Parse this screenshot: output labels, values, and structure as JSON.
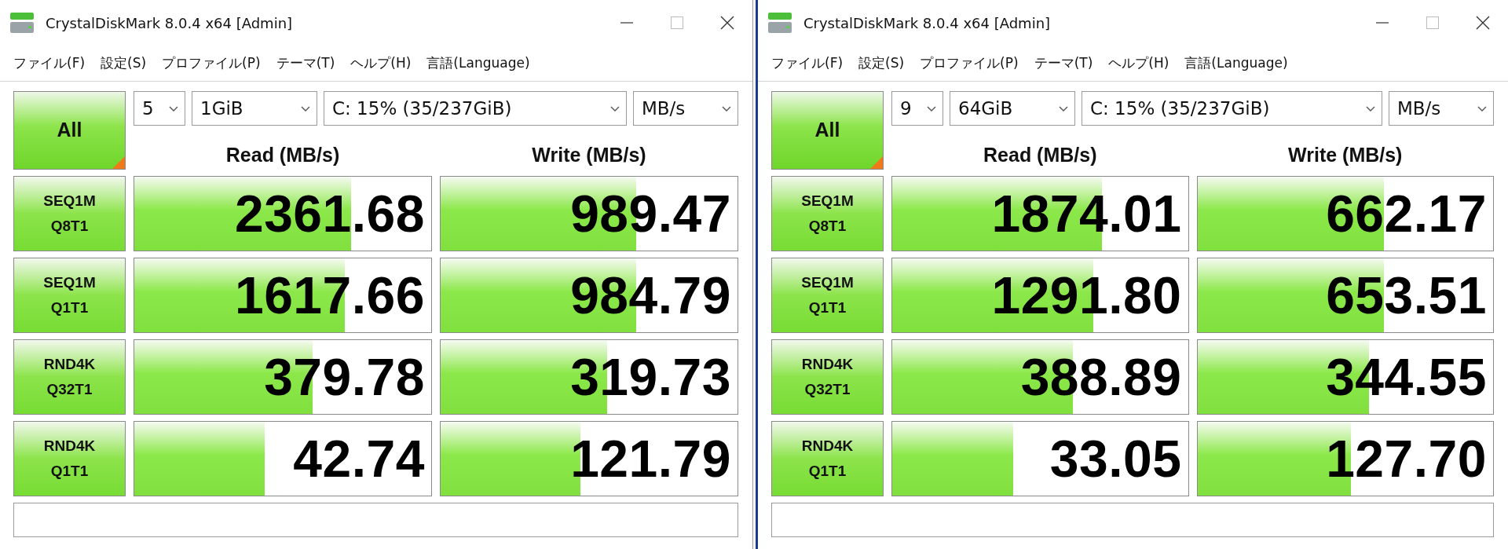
{
  "windows": [
    {
      "title": "CrystalDiskMark 8.0.4 x64 [Admin]",
      "menu": [
        "ファイル(F)",
        "設定(S)",
        "プロファイル(P)",
        "テーマ(T)",
        "ヘルプ(H)",
        "言語(Language)"
      ],
      "all_button": "All",
      "count": "5",
      "size": "1GiB",
      "drive": "C: 15% (35/237GiB)",
      "unit": "MB/s",
      "read_header": "Read (MB/s)",
      "write_header": "Write (MB/s)",
      "tests": [
        {
          "name": "SEQ1M",
          "params": "Q8T1",
          "read": {
            "value": "2361.68",
            "level": 0.73
          },
          "write": {
            "value": "989.47",
            "level": 0.66
          }
        },
        {
          "name": "SEQ1M",
          "params": "Q1T1",
          "read": {
            "value": "1617.66",
            "level": 0.71
          },
          "write": {
            "value": "984.79",
            "level": 0.66
          }
        },
        {
          "name": "RND4K",
          "params": "Q32T1",
          "read": {
            "value": "379.78",
            "level": 0.6
          },
          "write": {
            "value": "319.73",
            "level": 0.56
          }
        },
        {
          "name": "RND4K",
          "params": "Q1T1",
          "read": {
            "value": "42.74",
            "level": 0.44
          },
          "write": {
            "value": "121.79",
            "level": 0.47
          }
        }
      ]
    },
    {
      "title": "CrystalDiskMark 8.0.4 x64 [Admin]",
      "menu": [
        "ファイル(F)",
        "設定(S)",
        "プロファイル(P)",
        "テーマ(T)",
        "ヘルプ(H)",
        "言語(Language)"
      ],
      "all_button": "All",
      "count": "9",
      "size": "64GiB",
      "drive": "C: 15% (35/237GiB)",
      "unit": "MB/s",
      "read_header": "Read (MB/s)",
      "write_header": "Write (MB/s)",
      "tests": [
        {
          "name": "SEQ1M",
          "params": "Q8T1",
          "read": {
            "value": "1874.01",
            "level": 0.71
          },
          "write": {
            "value": "662.17",
            "level": 0.63
          }
        },
        {
          "name": "SEQ1M",
          "params": "Q1T1",
          "read": {
            "value": "1291.80",
            "level": 0.68
          },
          "write": {
            "value": "653.51",
            "level": 0.63
          }
        },
        {
          "name": "RND4K",
          "params": "Q32T1",
          "read": {
            "value": "388.89",
            "level": 0.61
          },
          "write": {
            "value": "344.55",
            "level": 0.58
          }
        },
        {
          "name": "RND4K",
          "params": "Q1T1",
          "read": {
            "value": "33.05",
            "level": 0.41
          },
          "write": {
            "value": "127.70",
            "level": 0.52
          }
        }
      ]
    }
  ]
}
